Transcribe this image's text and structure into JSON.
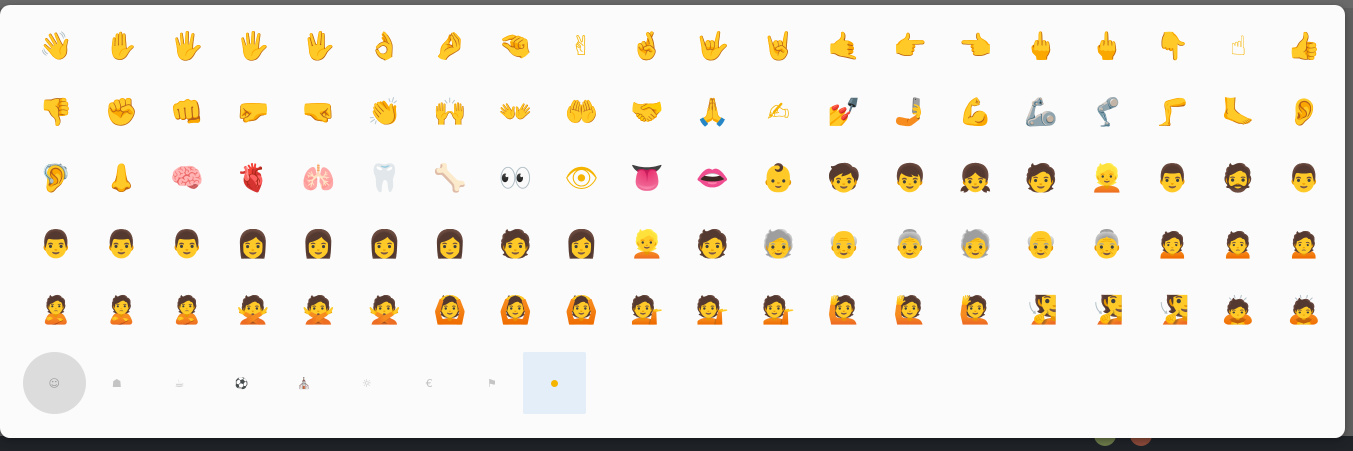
{
  "colors": {
    "panel_bg": "#fbfbfb",
    "accent_yellow": "#f4b400",
    "selected_tab_bg": "#e3eef9",
    "active_tab_bg": "#dcdcdc"
  },
  "emoji_grid": {
    "rows": [
      [
        "👋",
        "✋",
        "🖐",
        "🖐",
        "🖖",
        "👌",
        "🤌",
        "🤏",
        "✌",
        "🤞",
        "🤟",
        "🤘",
        "🤙",
        "👉",
        "👈",
        "🖕",
        "🖕",
        "👇",
        "☝",
        "👍"
      ],
      [
        "👎",
        "✊",
        "👊",
        "🤛",
        "🤜",
        "👏",
        "🙌",
        "👐",
        "🤲",
        "🤝",
        "🙏",
        "✍",
        "💅",
        "🤳",
        "💪",
        "🦾",
        "🦿",
        "🦵",
        "🦶",
        "👂"
      ],
      [
        "🦻",
        "👃",
        "🧠",
        "🫀",
        "🫁",
        "🦷",
        "🦴",
        "👀",
        "👁",
        "👅",
        "👄",
        "👶",
        "🧒",
        "👦",
        "👧",
        "🧑",
        "👱",
        "👨",
        "🧔",
        "👨"
      ],
      [
        "👨",
        "👨",
        "👨",
        "👩",
        "👩",
        "👩",
        "👩",
        "🧑",
        "👩",
        "👱",
        "🧑",
        "🧓",
        "👴",
        "👵",
        "🧓",
        "👴",
        "👵",
        "🙍",
        "🙍",
        "🙍"
      ],
      [
        "🙎",
        "🙎",
        "🙎",
        "🙅",
        "🙅",
        "🙅",
        "🙆",
        "🙆",
        "🙆",
        "💁",
        "💁",
        "💁",
        "🙋",
        "🙋",
        "🙋",
        "🧏",
        "🧏",
        "🧏",
        "🙇",
        "🙇"
      ]
    ]
  },
  "category_bar": {
    "tabs": [
      {
        "icon": "smiley-icon",
        "glyph": "☺",
        "state": "active"
      },
      {
        "icon": "people-icon",
        "glyph": "☗",
        "state": "normal"
      },
      {
        "icon": "food-icon",
        "glyph": "☕",
        "state": "normal"
      },
      {
        "icon": "activity-icon",
        "glyph": "⚽",
        "state": "normal"
      },
      {
        "icon": "travel-icon",
        "glyph": "⛪",
        "state": "normal"
      },
      {
        "icon": "objects-icon",
        "glyph": "☼",
        "state": "normal"
      },
      {
        "icon": "symbols-icon",
        "glyph": "€",
        "state": "normal"
      },
      {
        "icon": "flags-icon",
        "glyph": "⚑",
        "state": "normal"
      },
      {
        "icon": "skin-tone-icon",
        "glyph": "",
        "state": "selected"
      }
    ]
  }
}
